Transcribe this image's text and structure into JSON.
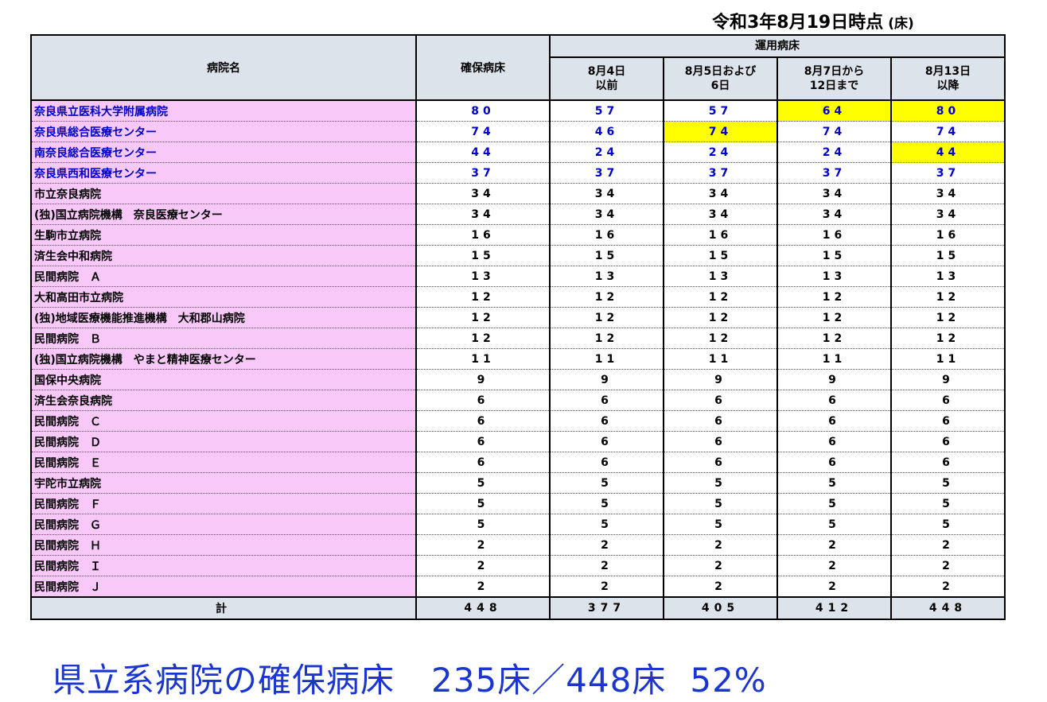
{
  "as_of": "令和3年8月19日時点",
  "unit": "(床)",
  "headers": {
    "hospital": "病院名",
    "secured": "確保病床",
    "operational": "運用病床",
    "periods": [
      {
        "l1": "8月4日",
        "l2": "以前"
      },
      {
        "l1": "8月5日および",
        "l2": "6日"
      },
      {
        "l1": "8月7日から",
        "l2": "12日まで"
      },
      {
        "l1": "8月13日",
        "l2": "以降"
      }
    ]
  },
  "rows": [
    {
      "name": "奈良県立医科大学附属病院",
      "prefectural": true,
      "secured": "80",
      "ops": [
        "57",
        "57",
        "64",
        "80"
      ],
      "highlight": [
        false,
        false,
        true,
        true
      ]
    },
    {
      "name": "奈良県総合医療センター",
      "prefectural": true,
      "secured": "74",
      "ops": [
        "46",
        "74",
        "74",
        "74"
      ],
      "highlight": [
        false,
        true,
        false,
        false
      ]
    },
    {
      "name": "南奈良総合医療センター",
      "prefectural": true,
      "secured": "44",
      "ops": [
        "24",
        "24",
        "24",
        "44"
      ],
      "highlight": [
        false,
        false,
        false,
        true
      ]
    },
    {
      "name": "奈良県西和医療センター",
      "prefectural": true,
      "secured": "37",
      "ops": [
        "37",
        "37",
        "37",
        "37"
      ],
      "highlight": [
        false,
        false,
        false,
        false
      ]
    },
    {
      "name": "市立奈良病院",
      "prefectural": false,
      "secured": "34",
      "ops": [
        "34",
        "34",
        "34",
        "34"
      ],
      "highlight": [
        false,
        false,
        false,
        false
      ]
    },
    {
      "name": "(独)国立病院機構　奈良医療センター",
      "prefectural": false,
      "secured": "34",
      "ops": [
        "34",
        "34",
        "34",
        "34"
      ],
      "highlight": [
        false,
        false,
        false,
        false
      ]
    },
    {
      "name": "生駒市立病院",
      "prefectural": false,
      "secured": "16",
      "ops": [
        "16",
        "16",
        "16",
        "16"
      ],
      "highlight": [
        false,
        false,
        false,
        false
      ]
    },
    {
      "name": "済生会中和病院",
      "prefectural": false,
      "secured": "15",
      "ops": [
        "15",
        "15",
        "15",
        "15"
      ],
      "highlight": [
        false,
        false,
        false,
        false
      ]
    },
    {
      "name": "民間病院　Ａ",
      "prefectural": false,
      "secured": "13",
      "ops": [
        "13",
        "13",
        "13",
        "13"
      ],
      "highlight": [
        false,
        false,
        false,
        false
      ]
    },
    {
      "name": "大和高田市立病院",
      "prefectural": false,
      "secured": "12",
      "ops": [
        "12",
        "12",
        "12",
        "12"
      ],
      "highlight": [
        false,
        false,
        false,
        false
      ]
    },
    {
      "name": "(独)地域医療機能推進機構　大和郡山病院",
      "prefectural": false,
      "secured": "12",
      "ops": [
        "12",
        "12",
        "12",
        "12"
      ],
      "highlight": [
        false,
        false,
        false,
        false
      ]
    },
    {
      "name": "民間病院　Ｂ",
      "prefectural": false,
      "secured": "12",
      "ops": [
        "12",
        "12",
        "12",
        "12"
      ],
      "highlight": [
        false,
        false,
        false,
        false
      ]
    },
    {
      "name": "(独)国立病院機構　やまと精神医療センター",
      "prefectural": false,
      "secured": "11",
      "ops": [
        "11",
        "11",
        "11",
        "11"
      ],
      "highlight": [
        false,
        false,
        false,
        false
      ]
    },
    {
      "name": "国保中央病院",
      "prefectural": false,
      "secured": "9",
      "ops": [
        "9",
        "9",
        "9",
        "9"
      ],
      "highlight": [
        false,
        false,
        false,
        false
      ]
    },
    {
      "name": "済生会奈良病院",
      "prefectural": false,
      "secured": "6",
      "ops": [
        "6",
        "6",
        "6",
        "6"
      ],
      "highlight": [
        false,
        false,
        false,
        false
      ]
    },
    {
      "name": "民間病院　Ｃ",
      "prefectural": false,
      "secured": "6",
      "ops": [
        "6",
        "6",
        "6",
        "6"
      ],
      "highlight": [
        false,
        false,
        false,
        false
      ]
    },
    {
      "name": "民間病院　Ｄ",
      "prefectural": false,
      "secured": "6",
      "ops": [
        "6",
        "6",
        "6",
        "6"
      ],
      "highlight": [
        false,
        false,
        false,
        false
      ]
    },
    {
      "name": "民間病院　Ｅ",
      "prefectural": false,
      "secured": "6",
      "ops": [
        "6",
        "6",
        "6",
        "6"
      ],
      "highlight": [
        false,
        false,
        false,
        false
      ]
    },
    {
      "name": "宇陀市立病院",
      "prefectural": false,
      "secured": "5",
      "ops": [
        "5",
        "5",
        "5",
        "5"
      ],
      "highlight": [
        false,
        false,
        false,
        false
      ]
    },
    {
      "name": "民間病院　Ｆ",
      "prefectural": false,
      "secured": "5",
      "ops": [
        "5",
        "5",
        "5",
        "5"
      ],
      "highlight": [
        false,
        false,
        false,
        false
      ]
    },
    {
      "name": "民間病院　Ｇ",
      "prefectural": false,
      "secured": "5",
      "ops": [
        "5",
        "5",
        "5",
        "5"
      ],
      "highlight": [
        false,
        false,
        false,
        false
      ]
    },
    {
      "name": "民間病院　Ｈ",
      "prefectural": false,
      "secured": "2",
      "ops": [
        "2",
        "2",
        "2",
        "2"
      ],
      "highlight": [
        false,
        false,
        false,
        false
      ]
    },
    {
      "name": "民間病院　Ｉ",
      "prefectural": false,
      "secured": "2",
      "ops": [
        "2",
        "2",
        "2",
        "2"
      ],
      "highlight": [
        false,
        false,
        false,
        false
      ]
    },
    {
      "name": "民間病院　Ｊ",
      "prefectural": false,
      "secured": "2",
      "ops": [
        "2",
        "2",
        "2",
        "2"
      ],
      "highlight": [
        false,
        false,
        false,
        false
      ]
    }
  ],
  "total": {
    "label": "計",
    "secured": "448",
    "ops": [
      "377",
      "405",
      "412",
      "448"
    ]
  },
  "summary": {
    "label": "県立系病院の確保病床",
    "ratio": "235床／448床",
    "percent": "52%"
  },
  "colors": {
    "name_cell_bg": "#f8c8f8",
    "header_bg": "#dde3ea",
    "highlight": "#ffff00",
    "prefectural_text": "#0000cc",
    "summary_text": "#1a35d0"
  }
}
